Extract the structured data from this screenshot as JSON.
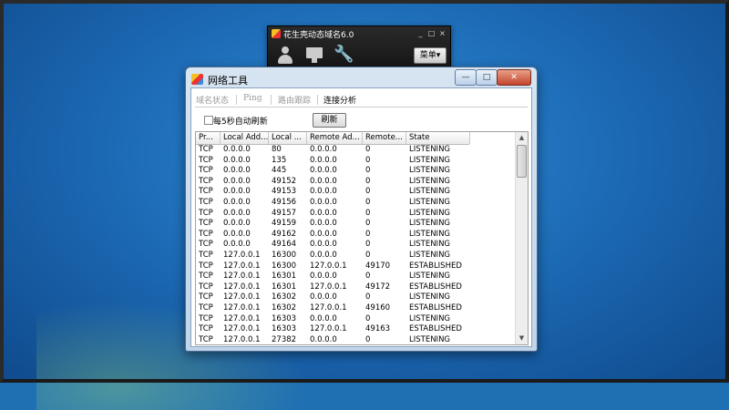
{
  "peanut_window": {
    "title": "花生壳动态域名6.0",
    "min": "_",
    "max": "□",
    "close": "×",
    "menu_label": "菜单▾",
    "toolbar_icons": [
      "user-icon",
      "monitor-icon",
      "wrench-icon"
    ]
  },
  "window": {
    "title": "网络工具",
    "min": "—",
    "max": "□",
    "close": "✕"
  },
  "tabs": [
    {
      "label": "域名状态",
      "active": false
    },
    {
      "label": "Ping",
      "active": false
    },
    {
      "label": "路由跟踪",
      "active": false
    },
    {
      "label": "连接分析",
      "active": true
    }
  ],
  "auto_refresh": {
    "label": "每5秒自动刷新",
    "checked": false
  },
  "refresh_button": "刷新",
  "table": {
    "columns": [
      "Pr...",
      "Local Add...",
      "Local ...",
      "Remote Ad...",
      "Remote...",
      "State"
    ],
    "rows": [
      [
        "TCP",
        "0.0.0.0",
        "80",
        "0.0.0.0",
        "0",
        "LISTENING"
      ],
      [
        "TCP",
        "0.0.0.0",
        "135",
        "0.0.0.0",
        "0",
        "LISTENING"
      ],
      [
        "TCP",
        "0.0.0.0",
        "445",
        "0.0.0.0",
        "0",
        "LISTENING"
      ],
      [
        "TCP",
        "0.0.0.0",
        "49152",
        "0.0.0.0",
        "0",
        "LISTENING"
      ],
      [
        "TCP",
        "0.0.0.0",
        "49153",
        "0.0.0.0",
        "0",
        "LISTENING"
      ],
      [
        "TCP",
        "0.0.0.0",
        "49156",
        "0.0.0.0",
        "0",
        "LISTENING"
      ],
      [
        "TCP",
        "0.0.0.0",
        "49157",
        "0.0.0.0",
        "0",
        "LISTENING"
      ],
      [
        "TCP",
        "0.0.0.0",
        "49159",
        "0.0.0.0",
        "0",
        "LISTENING"
      ],
      [
        "TCP",
        "0.0.0.0",
        "49162",
        "0.0.0.0",
        "0",
        "LISTENING"
      ],
      [
        "TCP",
        "0.0.0.0",
        "49164",
        "0.0.0.0",
        "0",
        "LISTENING"
      ],
      [
        "TCP",
        "127.0.0.1",
        "16300",
        "0.0.0.0",
        "0",
        "LISTENING"
      ],
      [
        "TCP",
        "127.0.0.1",
        "16300",
        "127.0.0.1",
        "49170",
        "ESTABLISHED"
      ],
      [
        "TCP",
        "127.0.0.1",
        "16301",
        "0.0.0.0",
        "0",
        "LISTENING"
      ],
      [
        "TCP",
        "127.0.0.1",
        "16301",
        "127.0.0.1",
        "49172",
        "ESTABLISHED"
      ],
      [
        "TCP",
        "127.0.0.1",
        "16302",
        "0.0.0.0",
        "0",
        "LISTENING"
      ],
      [
        "TCP",
        "127.0.0.1",
        "16302",
        "127.0.0.1",
        "49160",
        "ESTABLISHED"
      ],
      [
        "TCP",
        "127.0.0.1",
        "16303",
        "0.0.0.0",
        "0",
        "LISTENING"
      ],
      [
        "TCP",
        "127.0.0.1",
        "16303",
        "127.0.0.1",
        "49163",
        "ESTABLISHED"
      ],
      [
        "TCP",
        "127.0.0.1",
        "27382",
        "0.0.0.0",
        "0",
        "LISTENING"
      ]
    ]
  },
  "scrollbar": {
    "up": "▲",
    "down": "▼"
  }
}
